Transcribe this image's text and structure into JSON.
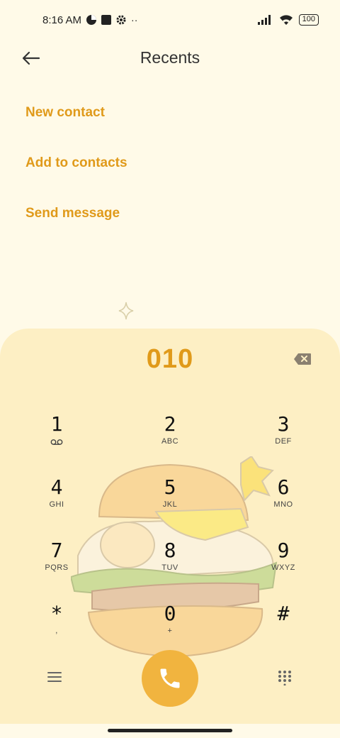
{
  "status_bar": {
    "time": "8:16 AM",
    "battery": "100"
  },
  "header": {
    "title": "Recents"
  },
  "actions": [
    {
      "label": "New contact"
    },
    {
      "label": "Add to contacts"
    },
    {
      "label": "Send message"
    }
  ],
  "dialer": {
    "entered_number": "010",
    "keys": [
      {
        "digit": "1",
        "letters": ""
      },
      {
        "digit": "2",
        "letters": "ABC"
      },
      {
        "digit": "3",
        "letters": "DEF"
      },
      {
        "digit": "4",
        "letters": "GHI"
      },
      {
        "digit": "5",
        "letters": "JKL"
      },
      {
        "digit": "6",
        "letters": "MNO"
      },
      {
        "digit": "7",
        "letters": "PQRS"
      },
      {
        "digit": "8",
        "letters": "TUV"
      },
      {
        "digit": "9",
        "letters": "WXYZ"
      },
      {
        "digit": "*",
        "letters": ","
      },
      {
        "digit": "0",
        "letters": "+"
      },
      {
        "digit": "#",
        "letters": ""
      }
    ]
  },
  "colors": {
    "accent": "#e09a1a",
    "call_button": "#f1b43f",
    "dialer_bg": "#fdefc4",
    "page_bg": "#fffae8"
  },
  "icons": {
    "back": "arrow-left-icon",
    "backspace": "backspace-icon",
    "voicemail": "voicemail-icon",
    "menu": "menu-icon",
    "call": "phone-icon",
    "keypad": "keypad-icon"
  }
}
